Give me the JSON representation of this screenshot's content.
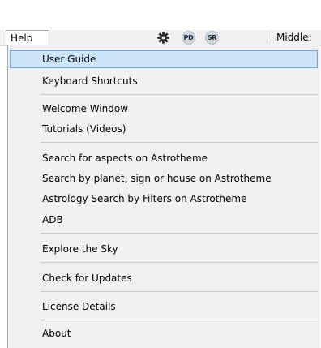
{
  "menubar": {
    "help_label": "Help",
    "icons": [
      "gear-icon",
      "pd-badge",
      "sr-badge"
    ],
    "pd_badge": "PD",
    "sr_badge": "SR",
    "middle_label": "Middle:"
  },
  "menu": {
    "items": [
      {
        "label": "User Guide",
        "selected": true
      },
      {
        "label": "Keyboard Shortcuts"
      },
      {
        "label": "Welcome Window"
      },
      {
        "label": "Tutorials (Videos)"
      },
      {
        "label": "Search for aspects on Astrotheme"
      },
      {
        "label": "Search by planet, sign or house on Astrotheme"
      },
      {
        "label": "Astrology Search by Filters on Astrotheme"
      },
      {
        "label": "ADB"
      },
      {
        "label": "Explore the Sky"
      },
      {
        "label": "Check for Updates"
      },
      {
        "label": "License Details"
      },
      {
        "label": "About"
      }
    ]
  },
  "colors": {
    "selection_bg": "#cce4f7",
    "selection_border": "#70a8e0",
    "menu_bg": "#f0f0f0"
  }
}
